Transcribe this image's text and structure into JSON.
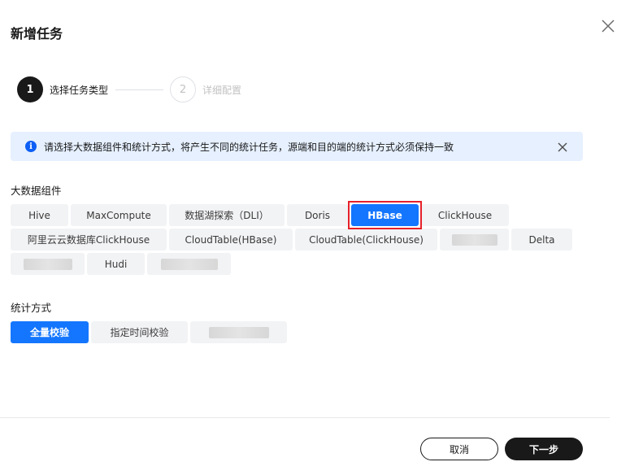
{
  "dialog": {
    "title": "新增任务",
    "close_icon": "close-icon"
  },
  "steps": [
    {
      "number": "1",
      "label": "选择任务类型",
      "state": "active"
    },
    {
      "number": "2",
      "label": "详细配置",
      "state": "pending"
    }
  ],
  "alert": {
    "icon": "info-icon",
    "text": "请选择大数据组件和统计方式，将产生不同的统计任务，源端和目的端的统计方式必须保持一致",
    "close_icon": "close-icon"
  },
  "components": {
    "label": "大数据组件",
    "selected": "HBase",
    "items": [
      {
        "label": "Hive"
      },
      {
        "label": "MaxCompute"
      },
      {
        "label": "数据湖探索（DLI）"
      },
      {
        "label": "Doris"
      },
      {
        "label": "HBase"
      },
      {
        "label": "ClickHouse"
      },
      {
        "label": "阿里云云数据库ClickHouse"
      },
      {
        "label": "CloudTable(HBase)"
      },
      {
        "label": "CloudTable(ClickHouse)"
      },
      {
        "label": ""
      },
      {
        "label": "Delta"
      },
      {
        "label": ""
      },
      {
        "label": "Hudi"
      },
      {
        "label": ""
      }
    ]
  },
  "stats": {
    "label": "统计方式",
    "selected": "全量校验",
    "items": [
      {
        "label": "全量校验"
      },
      {
        "label": "指定时间校验"
      },
      {
        "label": ""
      }
    ]
  },
  "footer": {
    "cancel_label": "取消",
    "next_label": "下一步"
  },
  "colors": {
    "accent": "#1476ff",
    "dark": "#191919",
    "alert_bg": "#e6f0ff",
    "info": "#0d5ef5",
    "highlight": "#e6212a"
  }
}
